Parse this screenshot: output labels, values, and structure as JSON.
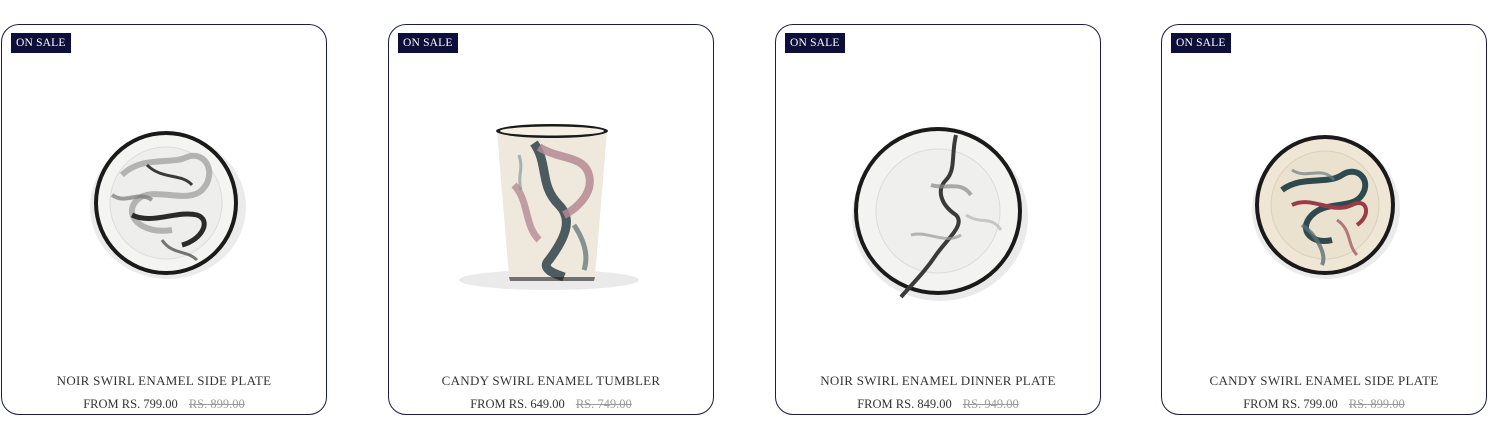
{
  "products": [
    {
      "badge": "ON SALE",
      "title": "NOIR SWIRL ENAMEL SIDE PLATE",
      "price": "FROM RS. 799.00",
      "compare_price": "RS. 899.00",
      "image_icon": "noir-side-plate-image"
    },
    {
      "badge": "ON SALE",
      "title": "CANDY SWIRL ENAMEL TUMBLER",
      "price": "FROM RS. 649.00",
      "compare_price": "RS. 749.00",
      "image_icon": "candy-tumbler-image"
    },
    {
      "badge": "ON SALE",
      "title": "NOIR SWIRL ENAMEL DINNER PLATE",
      "price": "FROM RS. 849.00",
      "compare_price": "RS. 949.00",
      "image_icon": "noir-dinner-plate-image"
    },
    {
      "badge": "ON SALE",
      "title": "CANDY SWIRL ENAMEL SIDE PLATE",
      "price": "FROM RS. 799.00",
      "compare_price": "RS. 899.00",
      "image_icon": "candy-side-plate-image"
    }
  ],
  "colors": {
    "badge_bg": "#0d0f3a",
    "card_border": "#1b1d45",
    "text": "#333333",
    "strike_text": "#9a9a9a"
  }
}
